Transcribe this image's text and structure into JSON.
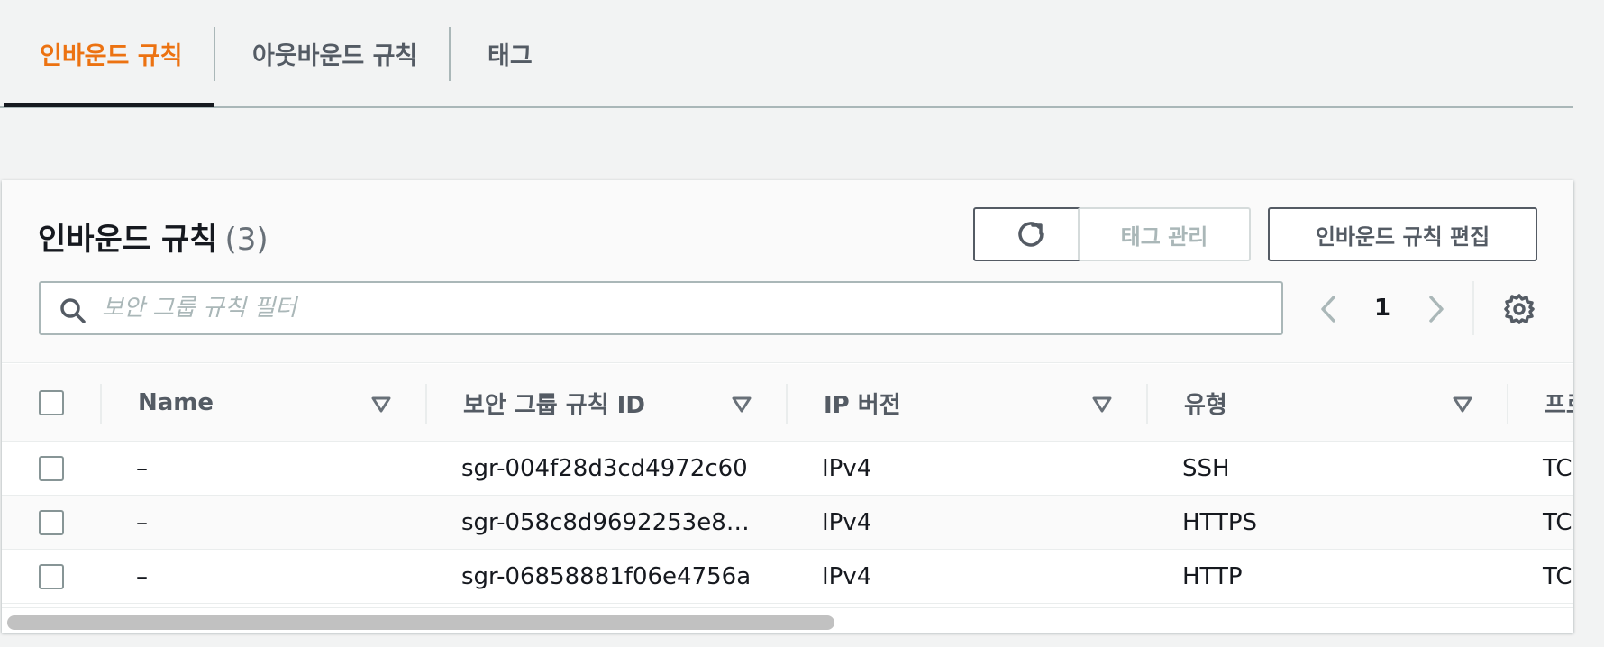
{
  "tabs": [
    {
      "label": "인바운드 규칙",
      "active": true
    },
    {
      "label": "아웃바운드 규칙",
      "active": false
    },
    {
      "label": "태그",
      "active": false
    }
  ],
  "panel": {
    "title": "인바운드 규칙",
    "count": "(3)",
    "buttons": {
      "refresh_icon": "refresh-icon",
      "manage_tags": "태그 관리",
      "edit_inbound_rules": "인바운드 규칙 편집"
    },
    "search": {
      "placeholder": "보안 그룹 규칙 필터",
      "value": ""
    },
    "pagination": {
      "current_page": "1"
    }
  },
  "table": {
    "columns": [
      "Name",
      "보안 그룹 규칙 ID",
      "IP 버전",
      "유형",
      "프로"
    ],
    "rows": [
      {
        "name": "–",
        "rule_id": "sgr-004f28d3cd4972c60",
        "ip_version": "IPv4",
        "type": "SSH",
        "protocol": "TC"
      },
      {
        "name": "–",
        "rule_id": "sgr-058c8d9692253e8…",
        "ip_version": "IPv4",
        "type": "HTTPS",
        "protocol": "TC"
      },
      {
        "name": "–",
        "rule_id": "sgr-06858881f06e4756a",
        "ip_version": "IPv4",
        "type": "HTTP",
        "protocol": "TC"
      }
    ]
  },
  "colors": {
    "active_tab": "#ec7211",
    "text_primary": "#16191f",
    "text_secondary": "#545b64",
    "border": "#aab7b8",
    "scrollbar_thumb": "#c1c1c1"
  }
}
